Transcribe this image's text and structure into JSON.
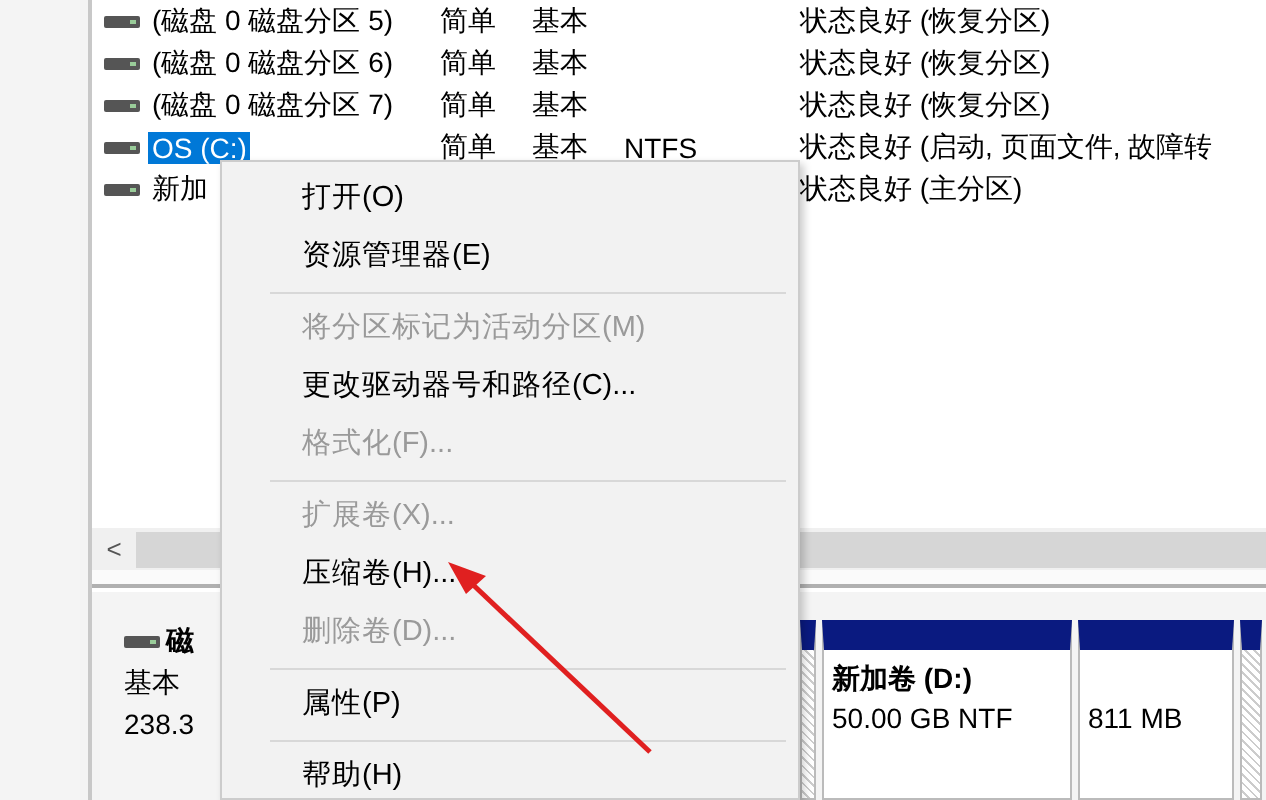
{
  "volumes": [
    {
      "name": "(磁盘 0 磁盘分区 5)",
      "layout": "简单",
      "type": "基本",
      "status": "状态良好 (恢复分区)",
      "selected": false
    },
    {
      "name": "(磁盘 0 磁盘分区 6)",
      "layout": "简单",
      "type": "基本",
      "status": "状态良好 (恢复分区)",
      "selected": false
    },
    {
      "name": "(磁盘 0 磁盘分区 7)",
      "layout": "简单",
      "type": "基本",
      "status": "状态良好 (恢复分区)",
      "selected": false
    },
    {
      "name": "OS (C:)",
      "layout": "简单",
      "type": "基本",
      "file_system": "NTFS",
      "status": "状态良好 (启动, 页面文件, 故障转",
      "selected": true
    },
    {
      "name": "新加",
      "status": "状态良好 (主分区)",
      "selected": false
    }
  ],
  "scrollbar": {
    "arrow": "<"
  },
  "context_menu": [
    {
      "kind": "item",
      "label": "打开(O)",
      "disabled": false
    },
    {
      "kind": "item",
      "label": "资源管理器(E)",
      "disabled": false
    },
    {
      "kind": "separator"
    },
    {
      "kind": "item",
      "label": "将分区标记为活动分区(M)",
      "disabled": true
    },
    {
      "kind": "item",
      "label": "更改驱动器号和路径(C)...",
      "disabled": false
    },
    {
      "kind": "item",
      "label": "格式化(F)...",
      "disabled": true
    },
    {
      "kind": "separator"
    },
    {
      "kind": "item",
      "label": "扩展卷(X)...",
      "disabled": true
    },
    {
      "kind": "item",
      "label": "压缩卷(H)...",
      "disabled": false
    },
    {
      "kind": "item",
      "label": "删除卷(D)...",
      "disabled": true
    },
    {
      "kind": "separator"
    },
    {
      "kind": "item",
      "label": "属性(P)",
      "disabled": false
    },
    {
      "kind": "separator"
    },
    {
      "kind": "item",
      "label": "帮助(H)",
      "disabled": false
    }
  ],
  "disk": {
    "title": "磁",
    "type": "基本",
    "size": "238.3"
  },
  "partitions": [
    {
      "kind": "partial"
    },
    {
      "kind": "volume",
      "title": "新加卷 (D:)",
      "detail": "50.00 GB NTF"
    },
    {
      "kind": "volume",
      "detail": "811 MB"
    },
    {
      "kind": "partial"
    }
  ]
}
